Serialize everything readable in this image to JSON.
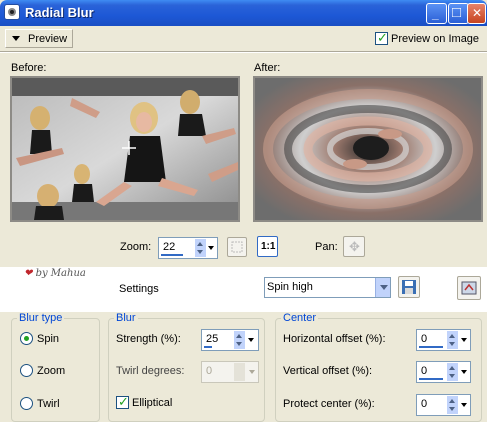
{
  "window": {
    "title": "Radial Blur",
    "minimize_glyph": "_",
    "maximize_glyph": "□",
    "close_glyph": "✕"
  },
  "toolbar": {
    "preview_button": "Preview",
    "preview_on_image_label": "Preview on Image",
    "preview_on_image_checked": true
  },
  "panes": {
    "before_label": "Before:",
    "after_label": "After:"
  },
  "zoom": {
    "label": "Zoom:",
    "value": "22",
    "one_to_one_label": "1:1",
    "pan_label": "Pan:"
  },
  "settings": {
    "logo_text": "by Mahua",
    "label": "Settings",
    "preset_value": "Spin high"
  },
  "blur_type": {
    "title": "Blur type",
    "options": [
      "Spin",
      "Zoom",
      "Twirl"
    ],
    "selected": "Spin"
  },
  "blur": {
    "title": "Blur",
    "strength_label": "Strength (%):",
    "strength_value": "25",
    "twirl_label": "Twirl degrees:",
    "twirl_value": "0",
    "elliptical_label": "Elliptical",
    "elliptical_checked": true
  },
  "center": {
    "title": "Center",
    "horizontal_label": "Horizontal offset (%):",
    "horizontal_value": "0",
    "vertical_label": "Vertical offset (%):",
    "vertical_value": "0",
    "protect_label": "Protect center (%):",
    "protect_value": "0"
  },
  "colors": {
    "title_bar": "#2a63d8",
    "group_title": "#0046d5",
    "check_green": "#21a121",
    "window_bg": "#ece9d8"
  }
}
